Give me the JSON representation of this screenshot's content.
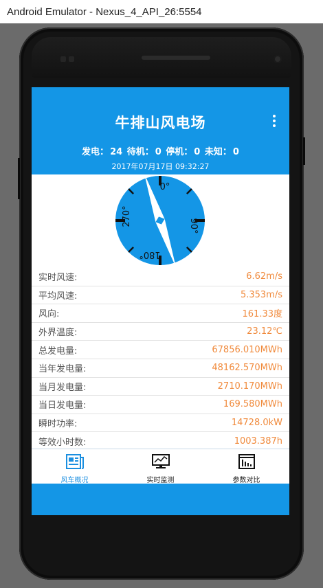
{
  "window": {
    "title": "Android Emulator - Nexus_4_API_26:5554"
  },
  "app": {
    "title": "牛排山风电场",
    "status": {
      "generating_label": "发电：",
      "generating_count": "24",
      "standby_label": "待机：",
      "standby_count": "0",
      "stopped_label": "停机：",
      "stopped_count": "0",
      "unknown_label": "未知：",
      "unknown_count": "0"
    },
    "timestamp": "2017年07月17日 09:32:27",
    "compass": {
      "labels": {
        "north": "0°",
        "west": "270°",
        "east": "90°",
        "south": "180°"
      },
      "wind_direction_deg": 161.33,
      "colors": {
        "dial": "#1496e6",
        "needle": "#ffffff",
        "ticks": "#111111"
      }
    },
    "metrics": [
      {
        "label": "实时风速:",
        "value": "6.62m/s"
      },
      {
        "label": "平均风速:",
        "value": "5.353m/s"
      },
      {
        "label": "风向:",
        "value": "161.33度"
      },
      {
        "label": "外界温度:",
        "value": "23.12℃"
      },
      {
        "label": "总发电量:",
        "value": "67856.010MWh"
      },
      {
        "label": "当年发电量:",
        "value": "48162.570MWh"
      },
      {
        "label": "当月发电量:",
        "value": "2710.170MWh"
      },
      {
        "label": "当日发电量:",
        "value": "169.580MWh"
      },
      {
        "label": "瞬时功率:",
        "value": "14728.0kW"
      },
      {
        "label": "等效小时数:",
        "value": "1003.387h"
      }
    ],
    "tabs": [
      {
        "label": "风车概况",
        "icon": "document-icon",
        "active": true
      },
      {
        "label": "实时监测",
        "icon": "monitor-chart-icon",
        "active": false
      },
      {
        "label": "参数对比",
        "icon": "bar-chart-icon",
        "active": false
      }
    ],
    "colors": {
      "primary": "#1496e6",
      "value_text": "#f08a3c",
      "active_tab": "#1b8fe0"
    }
  }
}
